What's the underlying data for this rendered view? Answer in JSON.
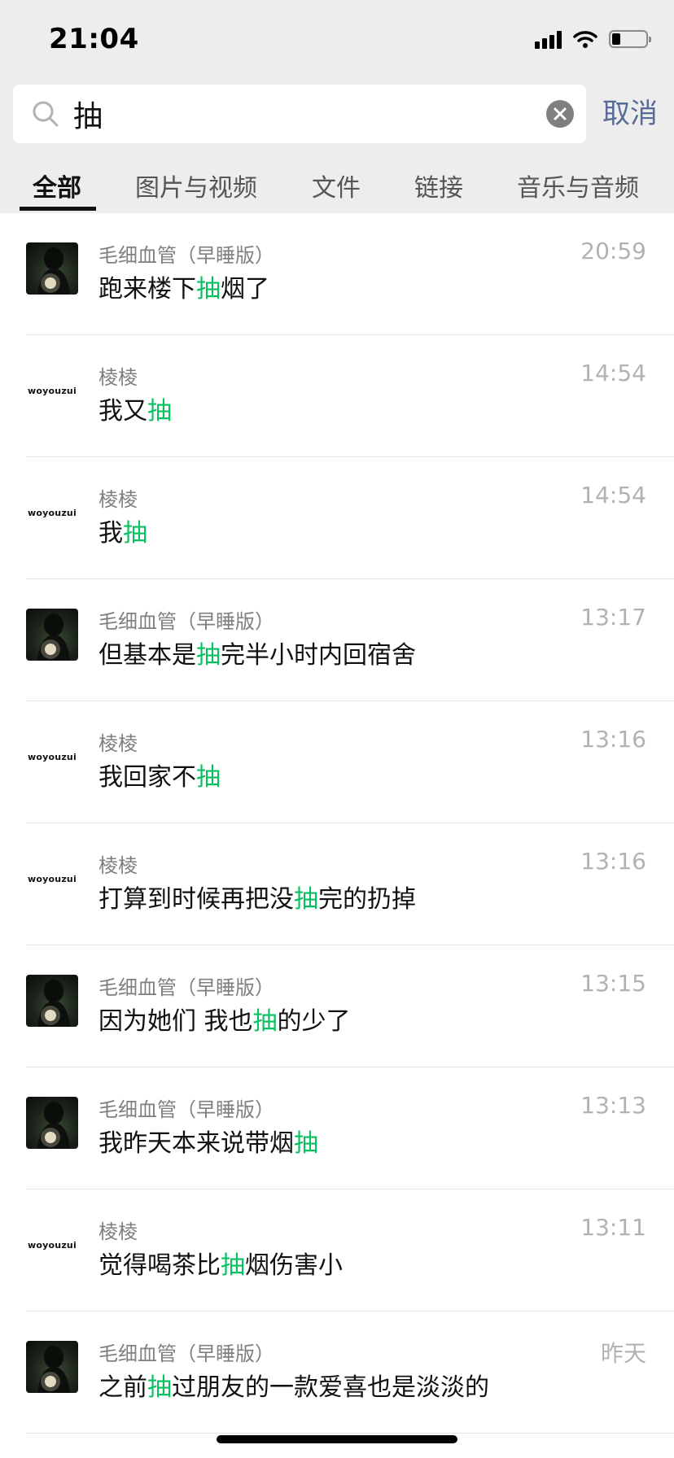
{
  "status_bar": {
    "time": "21:04",
    "icons": [
      "cellular-signal-icon",
      "wifi-icon",
      "battery-icon"
    ],
    "battery_level": 0.25
  },
  "search": {
    "query": "抽",
    "icon": "search-icon",
    "clear_icon": "clear-icon",
    "cancel_label": "取消"
  },
  "tabs": [
    {
      "label": "全部",
      "active": true
    },
    {
      "label": "图片与视频",
      "active": false
    },
    {
      "label": "文件",
      "active": false
    },
    {
      "label": "链接",
      "active": false
    },
    {
      "label": "音乐与音频",
      "active": false
    }
  ],
  "highlight_color": "#07c160",
  "accent_color": "#576b95",
  "results": [
    {
      "avatar": "photo",
      "name": "毛细血管（早睡版）",
      "time": "20:59",
      "before": "跑来楼下",
      "match": "抽",
      "after": "烟了"
    },
    {
      "avatar": "text",
      "avatar_text": "woyouzui",
      "name": "棱棱",
      "time": "14:54",
      "before": "我又",
      "match": "抽",
      "after": ""
    },
    {
      "avatar": "text",
      "avatar_text": "woyouzui",
      "name": "棱棱",
      "time": "14:54",
      "before": "我",
      "match": "抽",
      "after": ""
    },
    {
      "avatar": "photo",
      "name": "毛细血管（早睡版）",
      "time": "13:17",
      "before": "但基本是",
      "match": "抽",
      "after": "完半小时内回宿舍"
    },
    {
      "avatar": "text",
      "avatar_text": "woyouzui",
      "name": "棱棱",
      "time": "13:16",
      "before": "我回家不",
      "match": "抽",
      "after": ""
    },
    {
      "avatar": "text",
      "avatar_text": "woyouzui",
      "name": "棱棱",
      "time": "13:16",
      "before": "打算到时候再把没",
      "match": "抽",
      "after": "完的扔掉"
    },
    {
      "avatar": "photo",
      "name": "毛细血管（早睡版）",
      "time": "13:15",
      "before": "因为她们 我也",
      "match": "抽",
      "after": "的少了"
    },
    {
      "avatar": "photo",
      "name": "毛细血管（早睡版）",
      "time": "13:13",
      "before": "我昨天本来说带烟",
      "match": "抽",
      "after": ""
    },
    {
      "avatar": "text",
      "avatar_text": "woyouzui",
      "name": "棱棱",
      "time": "13:11",
      "before": "觉得喝茶比",
      "match": "抽",
      "after": "烟伤害小"
    },
    {
      "avatar": "photo",
      "name": "毛细血管（早睡版）",
      "time": "昨天",
      "before": "之前",
      "match": "抽",
      "after": "过朋友的一款爱喜也是淡淡的"
    }
  ]
}
